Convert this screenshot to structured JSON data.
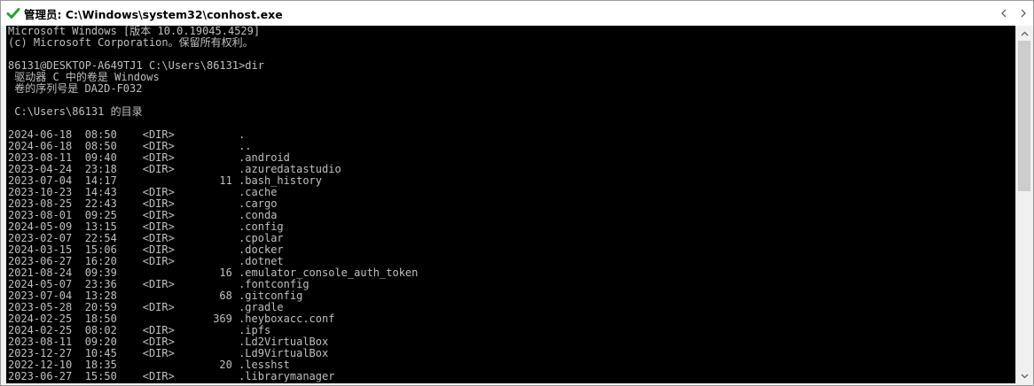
{
  "window": {
    "title": "管理员: C:\\Windows\\system32\\conhost.exe"
  },
  "console": {
    "lines": [
      "Microsoft Windows [版本 10.0.19045.4529]",
      "(c) Microsoft Corporation。保留所有权利。",
      "",
      "86131@DESKTOP-A649TJ1 C:\\Users\\86131>dir",
      " 驱动器 C 中的卷是 Windows",
      " 卷的序列号是 DA2D-F032",
      "",
      " C:\\Users\\86131 的目录",
      "",
      "2024-06-18  08:50    <DIR>          .",
      "2024-06-18  08:50    <DIR>          ..",
      "2023-08-11  09:40    <DIR>          .android",
      "2023-04-24  23:18    <DIR>          .azuredatastudio",
      "2023-07-04  14:17                11 .bash_history",
      "2023-10-23  14:43    <DIR>          .cache",
      "2023-08-25  22:43    <DIR>          .cargo",
      "2023-08-01  09:25    <DIR>          .conda",
      "2024-05-09  13:15    <DIR>          .config",
      "2023-02-07  22:54    <DIR>          .cpolar",
      "2024-03-15  15:06    <DIR>          .docker",
      "2023-06-27  16:20    <DIR>          .dotnet",
      "2021-08-24  09:39                16 .emulator_console_auth_token",
      "2024-05-07  23:36    <DIR>          .fontconfig",
      "2023-07-04  13:28                68 .gitconfig",
      "2023-05-28  20:59    <DIR>          .gradle",
      "2024-02-25  18:50               369 .heyboxacc.conf",
      "2024-02-25  08:02    <DIR>          .ipfs",
      "2023-08-11  09:20    <DIR>          .Ld2VirtualBox",
      "2023-12-27  10:45    <DIR>          .Ld9VirtualBox",
      "2022-12-10  18:35                20 .lesshst",
      "2023-06-27  15:50    <DIR>          .librarymanager"
    ]
  }
}
